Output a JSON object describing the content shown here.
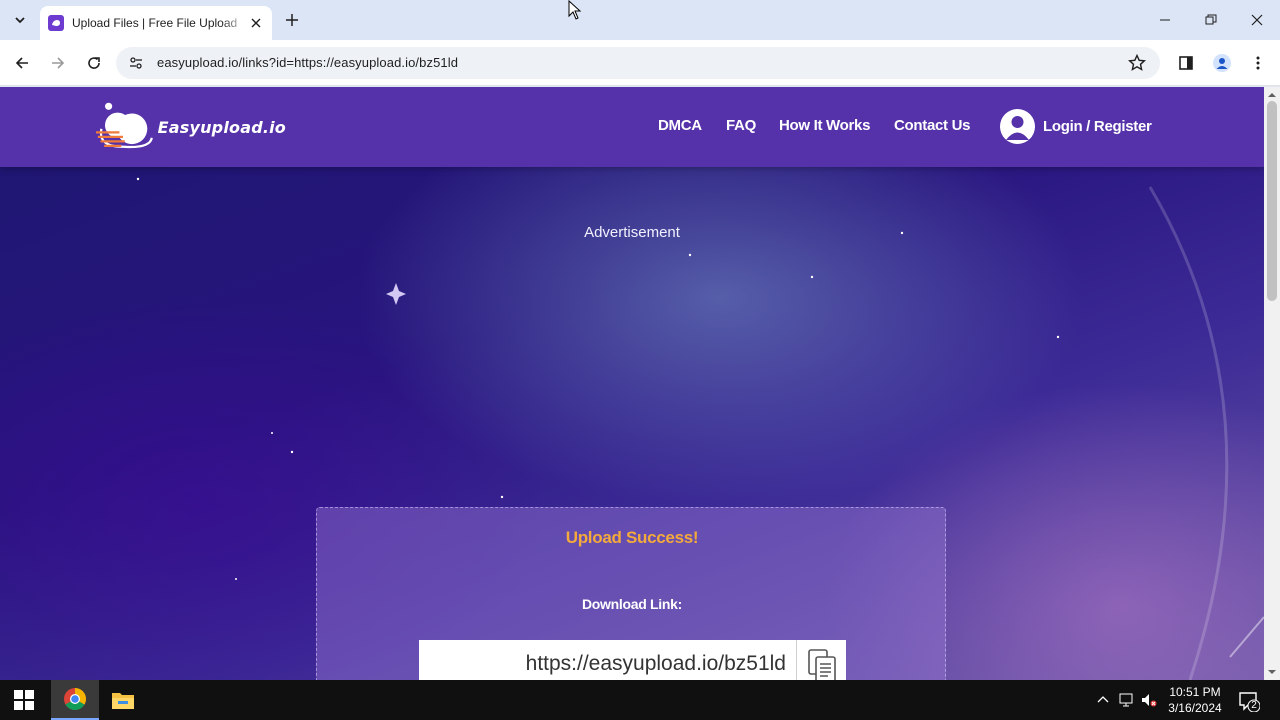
{
  "browser": {
    "tab_title": "Upload Files | Free File Upload",
    "url": "easyupload.io/links?id=https://easyupload.io/bz51ld"
  },
  "site": {
    "logo_text": "Easyupload.io",
    "nav": {
      "dmca": "DMCA",
      "faq": "FAQ",
      "how_it_works": "How It Works",
      "contact": "Contact Us",
      "login": "Login / Register"
    },
    "ad_label": "Advertisement",
    "upload": {
      "success": "Upload Success!",
      "download_label": "Download Link:",
      "download_url": "https://easyupload.io/bz51ld"
    },
    "colors": {
      "header": "#5632aa",
      "success": "#f3a93b"
    }
  },
  "taskbar": {
    "time": "10:51 PM",
    "date": "3/16/2024",
    "notification_count": "2"
  }
}
